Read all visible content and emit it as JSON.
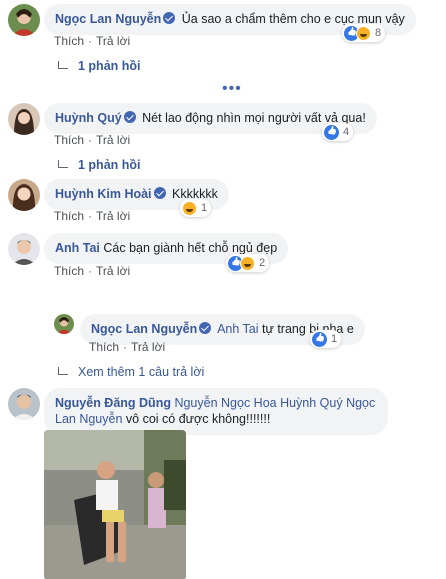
{
  "comments": [
    {
      "author": "Ngọc Lan Nguyễn",
      "text": "Ủa sao a chẩm thêm cho e cục mun vậy",
      "like_label": "Thích",
      "reply_label": "Trả lời",
      "reaction_count": "8",
      "replies_label": "1 phản hồi"
    },
    {
      "author": "Huỳnh Quý",
      "text": "Nét lao động nhìn mọi người vất vả qua!",
      "like_label": "Thích",
      "reply_label": "Trả lời",
      "reaction_count": "4",
      "replies_label": "1 phản hồi"
    },
    {
      "author": "Huỳnh Kim Hoài",
      "text": "Kkkkkkk",
      "like_label": "Thích",
      "reply_label": "Trả lời",
      "reaction_count": "1"
    },
    {
      "author": "Anh Tai",
      "text": "Các bạn giành hết chỗ ngủ đẹp",
      "like_label": "Thích",
      "reply_label": "Trả lời",
      "reaction_count": "2"
    },
    {
      "author": "Nguyễn Đăng Dũng",
      "mention": "Nguyễn Ngọc Hoa Huỳnh Quý Ngọc Lan Nguyễn",
      "text": "vô coi có được không!!!!!!!"
    }
  ],
  "reply": {
    "author": "Ngọc Lan Nguyễn",
    "mention": "Anh Tai",
    "text": "tự trang bị nha e",
    "like_label": "Thích",
    "reply_label": "Trả lời",
    "reaction_count": "1"
  },
  "more_dots": "•••",
  "view_more_label": "Xem thêm 1 câu trả lời",
  "colors": {
    "link": "#385898",
    "bubble": "#f2f3f5",
    "like": "#3578e5",
    "haha": "#f7b125"
  }
}
